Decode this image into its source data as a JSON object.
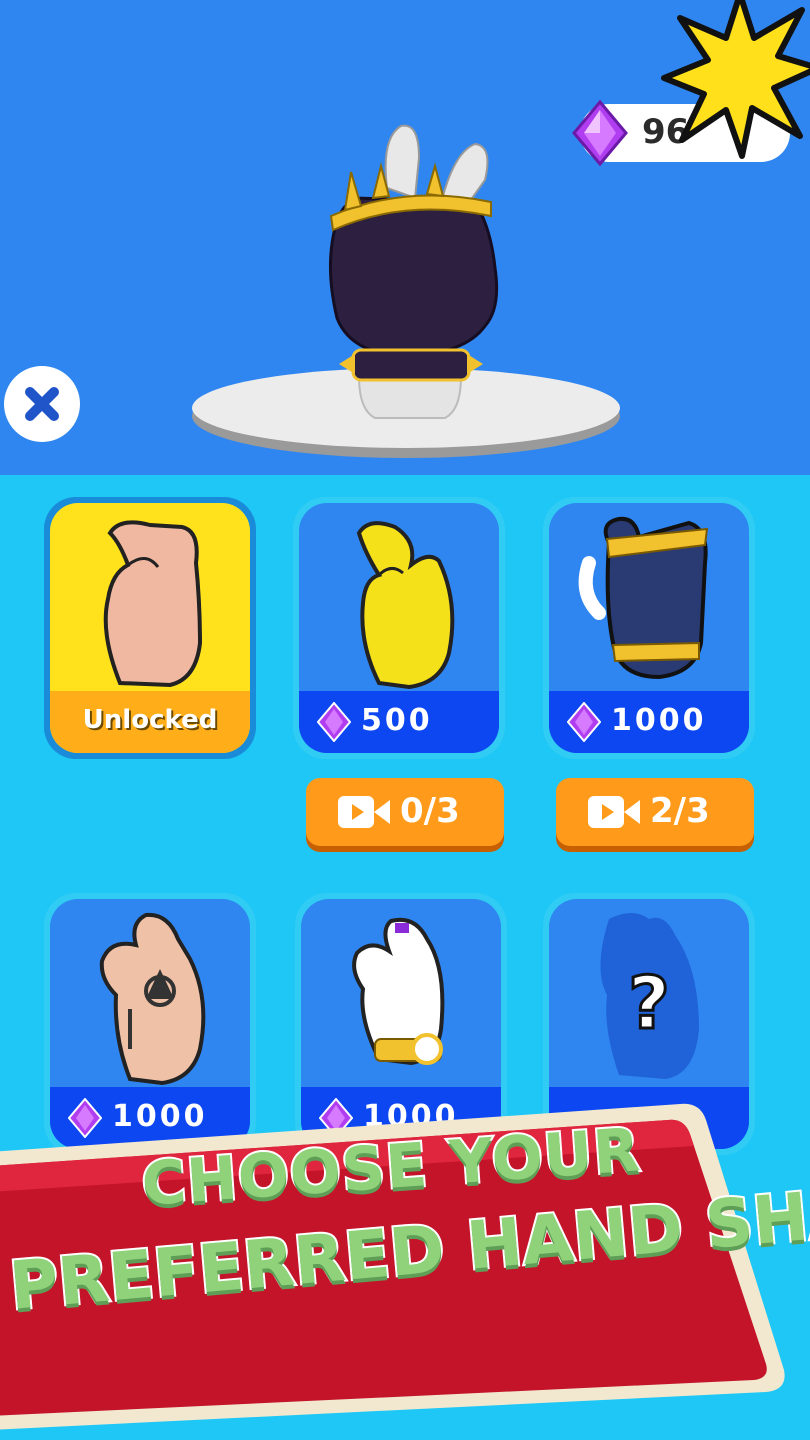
{
  "header": {
    "gem_count": "96"
  },
  "cards": [
    {
      "label": "Unlocked",
      "state": "selected",
      "hand": "skin-hand"
    },
    {
      "price": "500",
      "state": "locked",
      "hand": "yellow-hand"
    },
    {
      "price": "1000",
      "state": "locked",
      "hand": "spiked-glove-hand"
    },
    {
      "price": "1000",
      "state": "locked",
      "hand": "tattoo-hand"
    },
    {
      "price": "1000",
      "state": "locked",
      "hand": "white-glove-watch-hand"
    },
    {
      "price": "",
      "state": "mystery",
      "hand": "mystery-hand",
      "symbol": "?"
    }
  ],
  "ad_buttons": [
    {
      "count": "0/3"
    },
    {
      "count": "2/3"
    }
  ],
  "banner": {
    "line1": "CHOOSE YOUR",
    "line2": "PREFERRED HAND SHAPE"
  },
  "colors": {
    "top_bg": "#2f86f0",
    "grid_bg": "#1ec7f6",
    "price_bar": "#0c47f2",
    "unlocked_bar": "#ffae1a",
    "selected_card": "#ffe21c",
    "ad_button": "#ff9a1a",
    "banner_red": "#c3142a",
    "banner_text": "#8fd27a"
  },
  "icons": {
    "gem": "purple-gem-icon",
    "close": "close-icon",
    "video": "video-camera-icon",
    "burst": "star-burst-icon"
  }
}
